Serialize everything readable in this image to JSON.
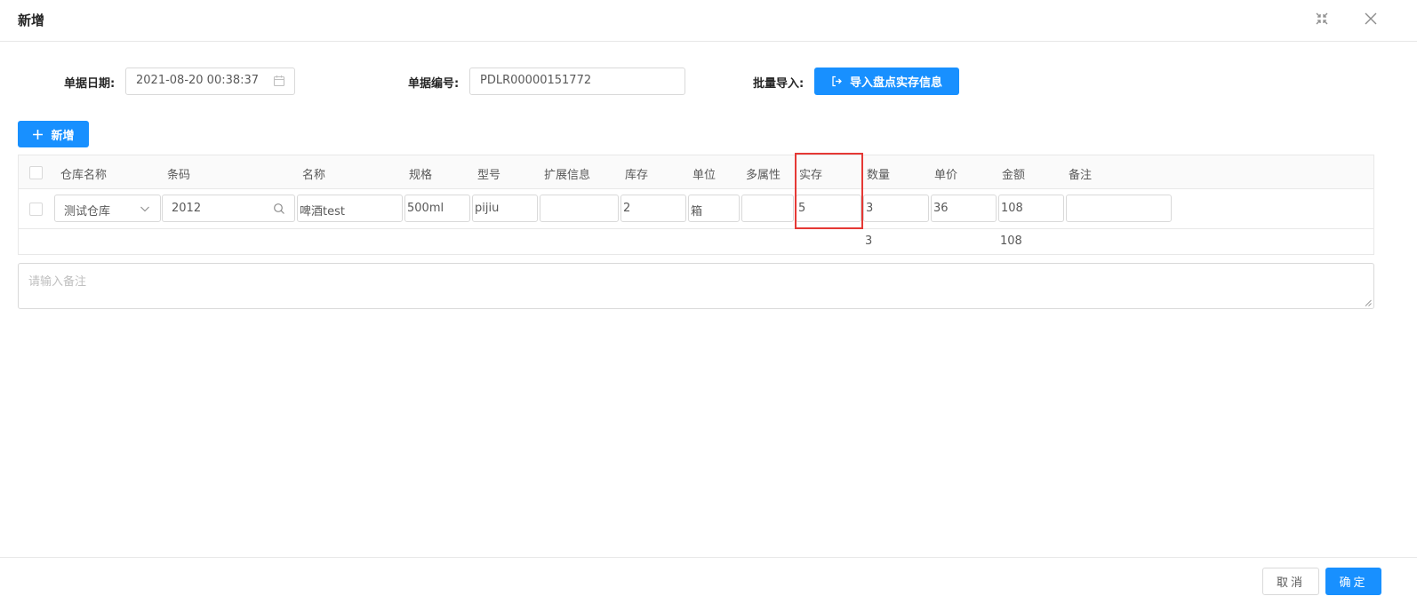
{
  "dialog": {
    "title": "新增"
  },
  "form": {
    "date_label": "单据日期:",
    "date_value": "2021-08-20 00:38:37",
    "number_label": "单据编号:",
    "number_value": "PDLR00000151772",
    "import_label": "批量导入:",
    "import_button": "导入盘点实存信息",
    "add_button": "新增"
  },
  "table": {
    "columns": [
      "仓库名称",
      "条码",
      "名称",
      "规格",
      "型号",
      "扩展信息",
      "库存",
      "单位",
      "多属性",
      "实存",
      "数量",
      "单价",
      "金额",
      "备注"
    ],
    "row": {
      "warehouse": "测试仓库",
      "barcode": "2012",
      "name": "啤酒test",
      "spec": "500ml",
      "model": "pijiu",
      "ext": "",
      "stock": "2",
      "unit": "箱",
      "attr": "",
      "actual": "5",
      "qty": "3",
      "price": "36",
      "amount": "108",
      "note": ""
    },
    "summary": {
      "qty": "3",
      "amount": "108"
    }
  },
  "remark": {
    "placeholder": "请输入备注"
  },
  "footer": {
    "cancel": "取消",
    "ok": "确定"
  },
  "colors": {
    "primary": "#1890ff",
    "highlight": "#e53935"
  }
}
